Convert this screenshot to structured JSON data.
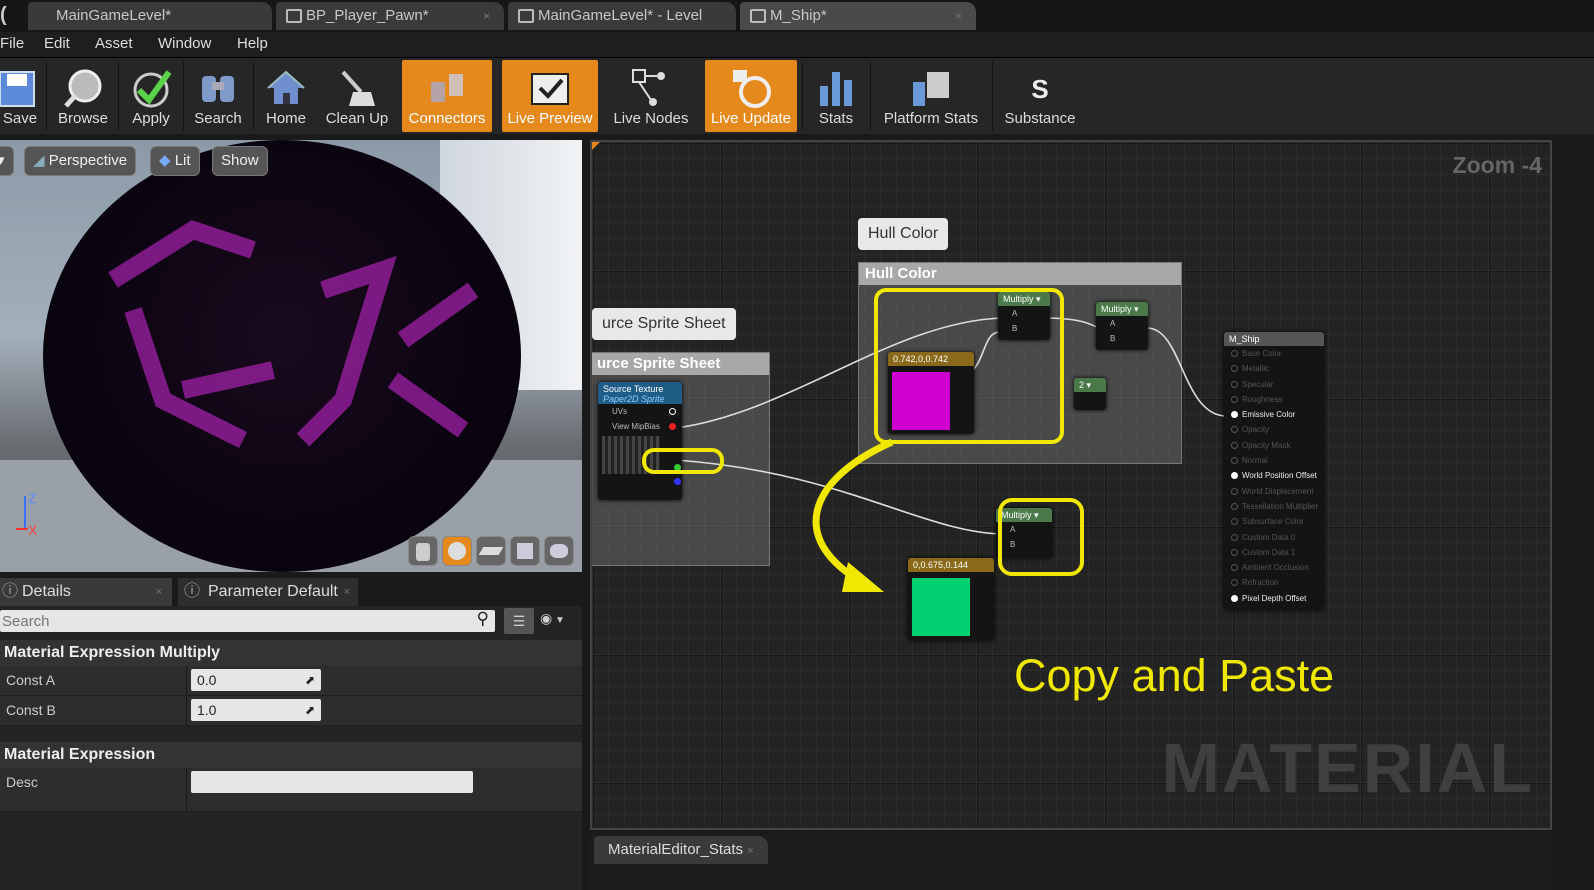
{
  "tabs": [
    {
      "label": "MainGameLevel*"
    },
    {
      "label": "BP_Player_Pawn*"
    },
    {
      "label": "MainGameLevel* - Level"
    },
    {
      "label": "M_Ship*"
    }
  ],
  "menu": [
    "File",
    "Edit",
    "Asset",
    "Window",
    "Help"
  ],
  "toolbar": {
    "buttons": [
      {
        "label": "Save",
        "icon": "save-icon",
        "active": false
      },
      {
        "label": "Browse",
        "icon": "browse-icon",
        "active": false
      },
      {
        "label": "Apply",
        "icon": "checkmark-icon",
        "active": false
      },
      {
        "label": "Search",
        "icon": "binoculars-icon",
        "active": false
      },
      {
        "label": "Home",
        "icon": "home-icon",
        "active": false
      },
      {
        "label": "Clean Up",
        "icon": "broom-icon",
        "active": false
      },
      {
        "label": "Connectors",
        "icon": "connectors-icon",
        "active": true
      },
      {
        "label": "Live Preview",
        "icon": "tv-icon",
        "active": true
      },
      {
        "label": "Live Nodes",
        "icon": "nodes-icon",
        "active": false
      },
      {
        "label": "Live Update",
        "icon": "refresh-icon",
        "active": true
      },
      {
        "label": "Stats",
        "icon": "bar-chart-icon",
        "active": false
      },
      {
        "label": "Platform Stats",
        "icon": "platform-icon",
        "active": false
      },
      {
        "label": "Substance",
        "icon": "substance-icon",
        "active": false
      }
    ]
  },
  "viewport": {
    "perspective": "Perspective",
    "lit": "Lit",
    "show": "Show",
    "axis_z": "Z",
    "axis_x": "X"
  },
  "details": {
    "tab1": "Details",
    "tab2": "Parameter Default",
    "search_placeholder": "Search",
    "section1": "Material Expression Multiply",
    "const_a_label": "Const A",
    "const_a_value": "0.0",
    "const_b_label": "Const B",
    "const_b_value": "1.0",
    "section2": "Material Expression",
    "desc_label": "Desc",
    "desc_value": ""
  },
  "graph": {
    "zoom": "Zoom -4",
    "watermark": "MATERIAL",
    "annotation": "Copy and Paste",
    "source_sprite_bubble": "urce Sprite Sheet",
    "source_sprite_title": "urce Sprite Sheet",
    "hull_bubble": "Hull Color",
    "hull_title": "Hull Color",
    "source_texture": {
      "title": "Source Texture",
      "subtitle": "Paper2D Sprite",
      "rows": [
        "UVs",
        "View MipBias"
      ]
    },
    "multiply1": {
      "title": "Multiply",
      "a": "A",
      "b": "B"
    },
    "multiply2": {
      "title": "Multiply",
      "a": "A",
      "b": "B"
    },
    "multiply3": {
      "title": "Multiply",
      "a": "A",
      "b": "B"
    },
    "const_2": "2",
    "color1": {
      "title": "0.742,0,0.742",
      "color": "#d000d0"
    },
    "color2": {
      "title": "0,0.675,0.144",
      "color": "#00d070"
    },
    "mship": {
      "title": "M_Ship",
      "pins": [
        {
          "label": "Base Color",
          "on": false
        },
        {
          "label": "Metallic",
          "on": false
        },
        {
          "label": "Specular",
          "on": false
        },
        {
          "label": "Roughness",
          "on": false
        },
        {
          "label": "Emissive Color",
          "on": true
        },
        {
          "label": "Opacity",
          "on": false
        },
        {
          "label": "Opacity Mask",
          "on": false
        },
        {
          "label": "Normal",
          "on": false
        },
        {
          "label": "World Position Offset",
          "on": true
        },
        {
          "label": "World Displacement",
          "on": false
        },
        {
          "label": "Tessellation Multiplier",
          "on": false
        },
        {
          "label": "Subsurface Color",
          "on": false
        },
        {
          "label": "Custom Data 0",
          "on": false
        },
        {
          "label": "Custom Data 1",
          "on": false
        },
        {
          "label": "Ambient Occlusion",
          "on": false
        },
        {
          "label": "Refraction",
          "on": false
        },
        {
          "label": "Pixel Depth Offset",
          "on": true
        }
      ]
    }
  },
  "stats_tab": "MaterialEditor_Stats"
}
